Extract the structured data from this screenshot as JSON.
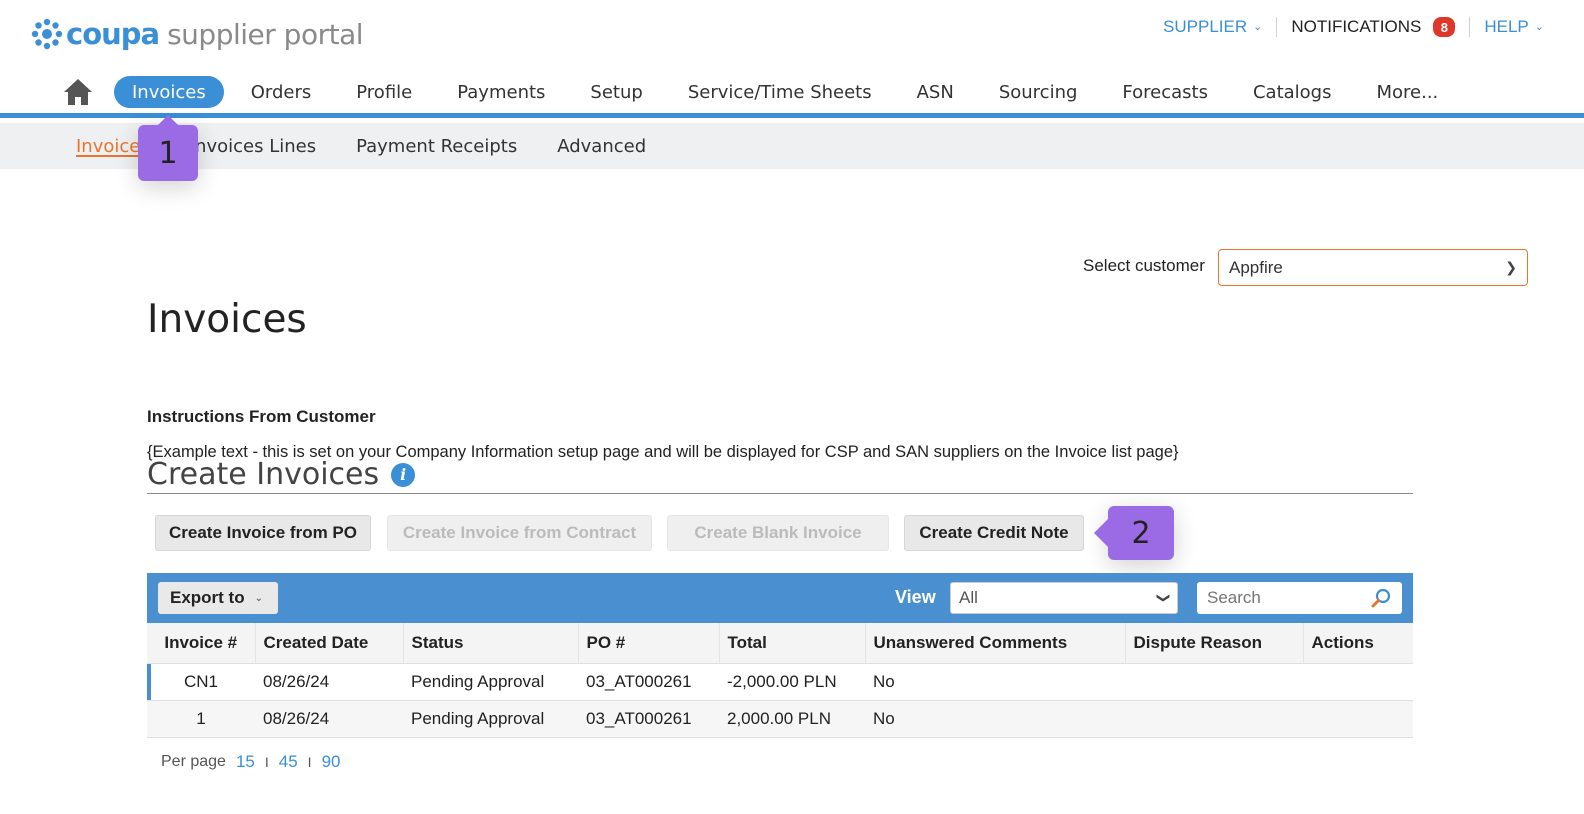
{
  "header": {
    "logo_text_a": "coupa",
    "logo_text_b": "supplier portal",
    "supplier_menu": "SUPPLIER",
    "notifications_label": "NOTIFICATIONS",
    "notifications_count": "8",
    "help_menu": "HELP"
  },
  "main_nav": {
    "items": [
      {
        "label": "Invoices",
        "active": true
      },
      {
        "label": "Orders"
      },
      {
        "label": "Profile"
      },
      {
        "label": "Payments"
      },
      {
        "label": "Setup"
      },
      {
        "label": "Service/Time Sheets"
      },
      {
        "label": "ASN"
      },
      {
        "label": "Sourcing"
      },
      {
        "label": "Forecasts"
      },
      {
        "label": "Catalogs"
      },
      {
        "label": "More..."
      }
    ]
  },
  "sub_nav": {
    "items": [
      {
        "label": "Invoices",
        "active": true
      },
      {
        "label": "Invoices Lines"
      },
      {
        "label": "Payment Receipts"
      },
      {
        "label": "Advanced"
      }
    ]
  },
  "annotations": {
    "marker_1": "1",
    "marker_2": "2"
  },
  "customer": {
    "label": "Select customer",
    "value": "Appfire"
  },
  "page": {
    "title": "Invoices",
    "instructions_title": "Instructions From Customer",
    "instructions_text": "{Example text - this is set on your Company Information setup page and will be displayed for CSP and SAN suppliers on the Invoice list page}",
    "create_title": "Create Invoices"
  },
  "actions": {
    "create_from_po": "Create Invoice from PO",
    "create_from_contract": "Create Invoice from Contract",
    "create_blank": "Create Blank Invoice",
    "create_credit_note": "Create Credit Note"
  },
  "toolbar": {
    "export_label": "Export to",
    "view_label": "View",
    "view_value": "All",
    "search_placeholder": "Search"
  },
  "table": {
    "columns": [
      "Invoice #",
      "Created Date",
      "Status",
      "PO #",
      "Total",
      "Unanswered Comments",
      "Dispute Reason",
      "Actions"
    ],
    "rows": [
      {
        "invoice": "CN1",
        "created": "08/26/24",
        "status": "Pending Approval",
        "po": "03_AT000261",
        "total": "-2,000.00 PLN",
        "comments": "No",
        "dispute": "",
        "actions": ""
      },
      {
        "invoice": "1",
        "created": "08/26/24",
        "status": "Pending Approval",
        "po": "03_AT000261",
        "total": "2,000.00 PLN",
        "comments": "No",
        "dispute": "",
        "actions": ""
      }
    ]
  },
  "pagination": {
    "label": "Per page",
    "options": [
      "15",
      "45",
      "90"
    ],
    "separator": "I"
  }
}
